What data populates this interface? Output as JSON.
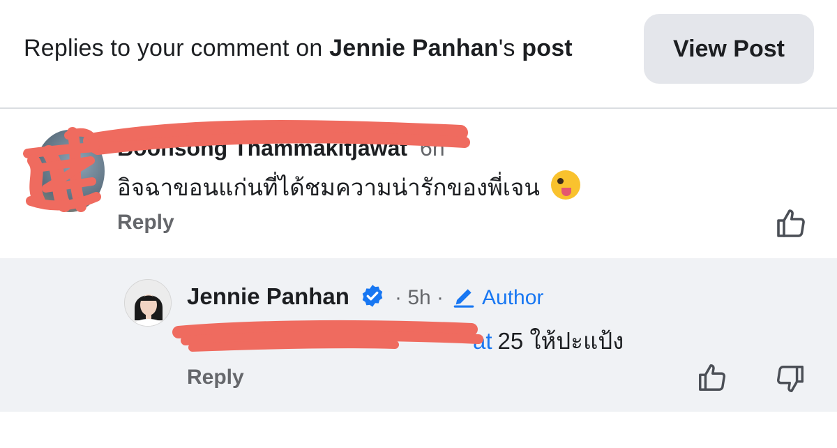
{
  "header": {
    "prefix": "Replies to your comment on ",
    "post_author": "Jennie Panhan",
    "possessive": "'s ",
    "post_word": "post",
    "view_post_label": "View Post"
  },
  "comment": {
    "author_name": "Boonsong Thammakitjawat",
    "time": "6h",
    "text": "อิจฉาขอนแก่นที่ได้ชมความน่ารักของพี่เจน",
    "emoji": "zany-face-emoji",
    "reply_label": "Reply"
  },
  "reply": {
    "author_name": "Jennie Panhan",
    "dot_time": "· 5h ·",
    "author_badge": "Author",
    "mention_tail": "at",
    "text": "25 ให้ปะแป้ง",
    "reply_label": "Reply"
  },
  "icons": {
    "verified": "verified-badge-icon",
    "pencil": "pencil-icon",
    "like": "thumbs-up-icon",
    "dislike": "thumbs-down-icon"
  },
  "colors": {
    "accent": "#1877f2",
    "secondary_text": "#65676b",
    "redaction": "#ef6b5f"
  }
}
